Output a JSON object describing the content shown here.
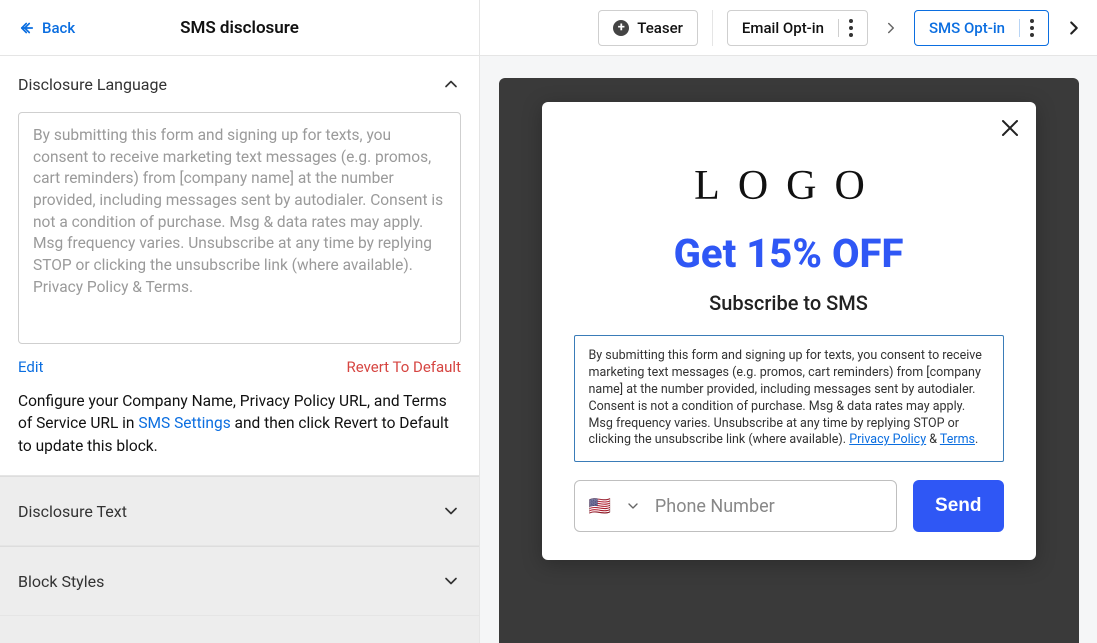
{
  "left": {
    "back": "Back",
    "title": "SMS disclosure",
    "section_lang": "Disclosure Language",
    "textarea": "By submitting this form and signing up for texts, you consent to receive marketing text messages (e.g. promos, cart reminders) from [company name] at the number provided, including messages sent by autodialer. Consent is not a condition of purchase. Msg & data rates may apply. Msg frequency varies. Unsubscribe at any time by replying STOP or clicking the unsubscribe link (where available). Privacy Policy & Terms.",
    "edit": "Edit",
    "revert": "Revert To Default",
    "help_pre": "Configure your Company Name, Privacy Policy URL, and Terms of Service URL in ",
    "help_link": "SMS Settings",
    "help_post": " and then click Revert to Default to update this block.",
    "section_text": "Disclosure Text",
    "section_styles": "Block Styles"
  },
  "top": {
    "teaser": "Teaser",
    "email": "Email Opt-in",
    "sms": "SMS Opt-in"
  },
  "popup": {
    "logo": "LOGO",
    "headline": "Get 15% OFF",
    "sub": "Subscribe to SMS",
    "disclosure_main": "By submitting this form and signing up for texts, you consent to receive marketing text messages (e.g. promos, cart reminders) from [company name] at the number provided, including messages sent by autodialer. Consent is not a condition of purchase. Msg & data rates may apply. Msg frequency varies. Unsubscribe at any time by replying STOP or clicking the unsubscribe link (where available). ",
    "privacy": "Privacy Policy",
    "amp": " & ",
    "terms": "Terms",
    "period": ".",
    "flag": "🇺🇸",
    "phone_placeholder": "Phone Number",
    "send": "Send"
  }
}
